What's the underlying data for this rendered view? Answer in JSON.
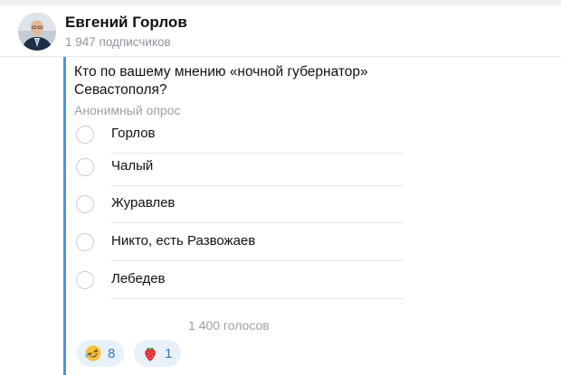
{
  "channel": {
    "name": "Евгений Горлов",
    "subscribers": "1 947 подписчиков"
  },
  "poll": {
    "question": "Кто по вашему мнению «ночной губернатор» Севастополя?",
    "type": "Анонимный опрос",
    "options": [
      {
        "label": "Горлов"
      },
      {
        "label": "Чалый"
      },
      {
        "label": "Журавлев"
      },
      {
        "label": "Никто, есть Развожаев"
      },
      {
        "label": "Лебедев"
      }
    ],
    "votes": "1 400 голосов"
  },
  "reactions": [
    {
      "icon": "rofl-face-icon",
      "count": "8"
    },
    {
      "icon": "strawberry-icon",
      "count": "1"
    }
  ],
  "colors": {
    "accent": "#4a97d6",
    "reaction_bg": "#e8f1fa",
    "reaction_text": "#2f77c2"
  }
}
